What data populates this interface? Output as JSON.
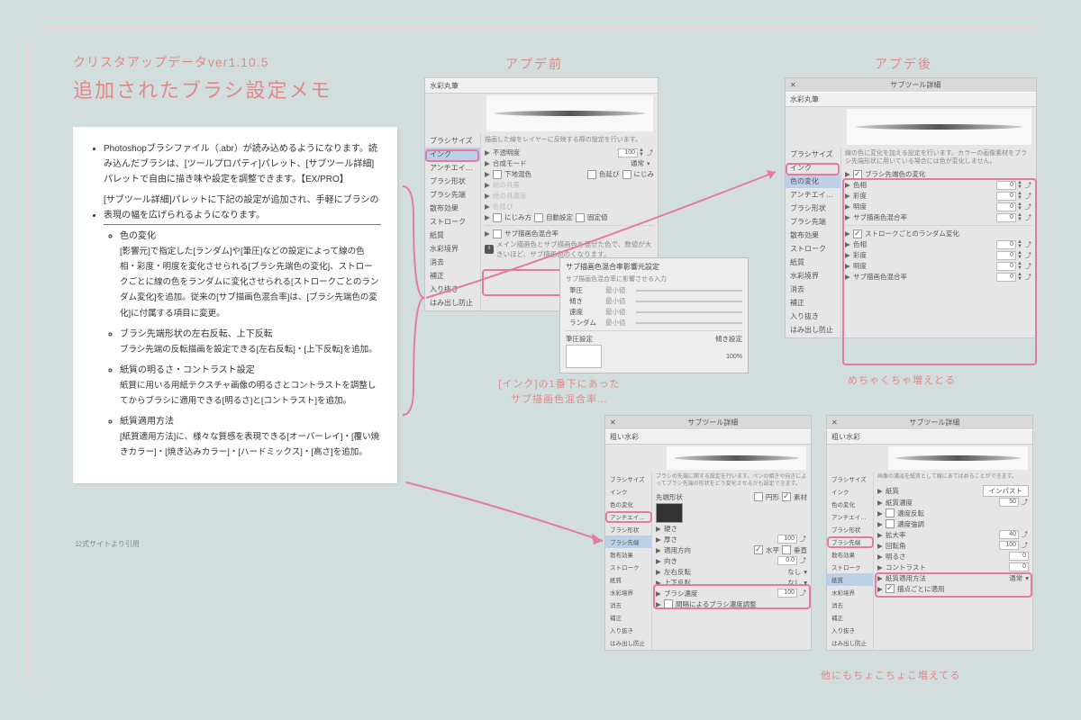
{
  "header": {
    "version": "クリスタアップデータver1.10.5",
    "title": "追加されたブラシ設定メモ",
    "before_label": "アプデ前",
    "after_label": "アプデ後"
  },
  "note": {
    "top_bullets": [
      "Photoshopブラシファイル（.abr）が読み込めるようになります。読み込んだブラシは、[ツールプロパティ]パレット、[サブツール詳細]パレットで自由に描き味や設定を調整できます。【EX/PRO】",
      "[サブツール詳細]パレットに下記の設定が追加され、手軽にブラシの表現の幅を広げられるようになります。"
    ],
    "sub": [
      {
        "title": "色の変化",
        "body": "[影響元]で指定した[ランダム]や[筆圧]などの設定によって線の色相・彩度・明度を変化させられる[ブラシ先端色の変化]、ストロークごとに線の色をランダムに変化させられる[ストロークごとのランダム変化]を追加。従来の[サブ描画色混合率]は、[ブラシ先端色の変化]に付属する項目に変更。"
      },
      {
        "title": "ブラシ先端形状の左右反転、上下反転",
        "body": "ブラシ先端の反転描画を設定できる[左右反転]・[上下反転]を追加。"
      },
      {
        "title": "紙質の明るさ・コントラスト設定",
        "body": "紙質に用いる用紙テクスチャ画像の明るさとコントラストを調整してからブラシに適用できる[明るさ]と[コントラスト]を追加。"
      },
      {
        "title": "紙質適用方法",
        "body": "[紙質適用方法]に、様々な質感を表現できる[オーバーレイ]・[覆い焼きカラー]・[焼き込みカラー]・[ハードミックス]・[高さ]を追加。"
      }
    ],
    "cite": "公式サイトより引用"
  },
  "panel_before": {
    "tool": "水彩丸筆",
    "sidebar": [
      "ブラシサイズ",
      "インク",
      "アンチエイリアス",
      "ブラシ形状",
      "ブラシ先端",
      "散布効果",
      "ストローク",
      "紙質",
      "水彩境界",
      "消去",
      "補正",
      "入り抜き",
      "はみ出し防止"
    ],
    "selected": "インク",
    "desc": "描画した線をレイヤーに反映する際の設定を行います。",
    "rows": {
      "opacity": "不透明度",
      "blend": "合成モード",
      "blend_val": "通常",
      "undermix": "下地混色",
      "colorext": "色延び",
      "blur": "にじみ",
      "l1": "絵の具量",
      "l2": "絵の具濃度",
      "l3": "色延び",
      "btn1": "にじみ方",
      "btn2": "自動設定",
      "btn3": "固定値",
      "sep": "サブ描画色混合率",
      "sep_desc": "メイン描画色とサブ描画色を混ぜた色で、数値が大きいほど、サブ描画色のくなります。"
    }
  },
  "popup": {
    "title": "サブ描画色混合率影響元設定",
    "sub": "サブ描画色混合率に影響させる入力",
    "items": [
      {
        "k": "筆圧",
        "a": "最小値"
      },
      {
        "k": "傾き",
        "a": "最小値"
      },
      {
        "k": "速度",
        "a": "最小値"
      },
      {
        "k": "ランダム",
        "a": "最小値"
      }
    ],
    "bottom1": "筆圧設定",
    "bottom2": "傾き設定"
  },
  "panel_after": {
    "title": "サブツール詳細",
    "tool": "水彩丸筆",
    "sidebar": [
      "ブラシサイズ",
      "インク",
      "色の変化",
      "アンチエイリアス",
      "ブラシ形状",
      "ブラシ先端",
      "散布効果",
      "ストローク",
      "紙質",
      "水彩境界",
      "消去",
      "補正",
      "入り抜き",
      "はみ出し防止"
    ],
    "selected": "色の変化",
    "desc": "線の色に変化を加える設定を行います。カラーの画像素材をブラシ先端形状に用いている場合には色が変化しません。",
    "group1": "ブラシ先端色の変化",
    "group2": "ストロークごとのランダム変化",
    "params": [
      {
        "name": "色相",
        "val": "0"
      },
      {
        "name": "彩度",
        "val": "0"
      },
      {
        "name": "明度",
        "val": "0"
      },
      {
        "name": "サブ描画色混合率",
        "val": "0"
      }
    ],
    "params2": [
      {
        "name": "色相",
        "val": "0"
      },
      {
        "name": "彩度",
        "val": "0"
      },
      {
        "name": "明度",
        "val": "0"
      },
      {
        "name": "サブ描画色混合率",
        "val": "0"
      }
    ]
  },
  "panel_bl": {
    "title": "サブツール詳細",
    "tool": "粗い水彩",
    "sidebar": [
      "ブラシサイズ",
      "インク",
      "色の変化",
      "アンチエイリアス",
      "ブラシ形状",
      "ブラシ先端",
      "散布効果",
      "ストローク",
      "紙質",
      "水彩境界",
      "消去",
      "補正",
      "入り抜き",
      "はみ出し防止"
    ],
    "selected": "ブラシ先端",
    "desc": "ブラシの先端に関する設定を行います。ペンの傾きや向きによってブラシ先端の形状をどう変化させるかも設定できます。",
    "tipsrc": "先端形状",
    "tipbtn1": "円形",
    "tipbtn2": "素材",
    "hard": "硬さ",
    "thick": "厚さ",
    "thick_val": "100",
    "apply": "適用方向",
    "apply_a": "水平",
    "apply_b": "垂直",
    "dir": "向き",
    "dir_val": "0.0",
    "flip_lr": "左右反転",
    "flip_ud": "上下反転",
    "flip_val": "なし",
    "interval": "ブラシ濃度",
    "interval_val": "100",
    "adjust": "間隔によるブラシ濃度調整"
  },
  "panel_br": {
    "title": "サブツール詳細",
    "tool": "粗い水彩",
    "sidebar": [
      "ブラシサイズ",
      "インク",
      "色の変化",
      "アンチエイリアス",
      "ブラシ形状",
      "ブラシ先端",
      "散布効果",
      "ストローク",
      "紙質",
      "水彩境界",
      "消去",
      "補正",
      "入り抜き",
      "はみ出し防止"
    ],
    "selected": "紙質",
    "desc": "画像の濃淡を紙質として線にあてはめることができます。",
    "tex": "紙質",
    "tex_val": "インパスト",
    "den": "紙質濃度",
    "den_val": "50",
    "inv": "濃度反転",
    "emph": "濃度強調",
    "scale": "拡大率",
    "scale_val": "40",
    "rot": "回転角",
    "rot_val": "100",
    "bright": "明るさ",
    "bright_val": "0",
    "contrast": "コントラスト",
    "contrast_val": "0",
    "method": "紙質適用方法",
    "method_val": "通常",
    "perdot": "描点ごとに適用"
  },
  "annotations": {
    "ink_note": "[インク]の1番下にあった\nサブ描画色混合率…",
    "after_note": "めちゃくちゃ増えとる",
    "bottom_note": "他にもちょこちょこ増えてる"
  }
}
